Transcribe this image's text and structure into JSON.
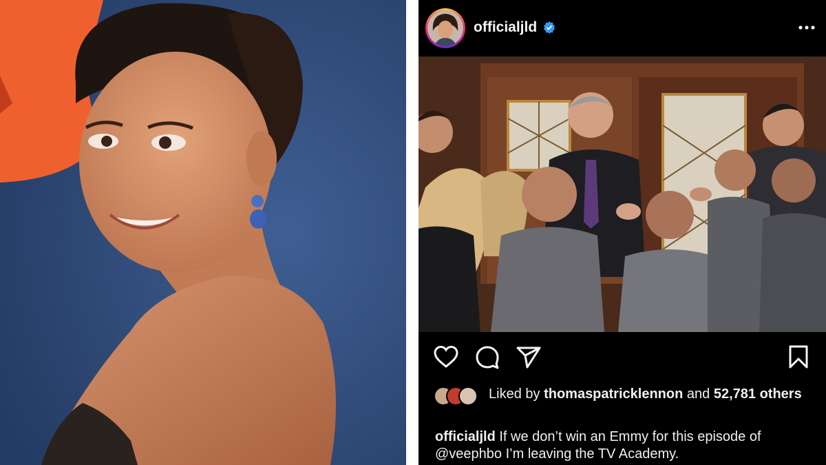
{
  "post": {
    "username": "officialjld",
    "verified": true,
    "likes": {
      "prefix": "Liked by",
      "liker": "thomaspatricklennon",
      "joiner": "and",
      "count": "52,781",
      "suffix": "others"
    },
    "caption": {
      "author": "officialjld",
      "text": "If we don’t win an Emmy for this episode of @veephbo I’m leaving the TV Academy."
    }
  },
  "icons": {
    "more": "more-horizontal-icon",
    "like": "heart-icon",
    "comment": "comment-icon",
    "share": "send-icon",
    "save": "bookmark-icon",
    "verified": "verified-badge-icon"
  },
  "colors": {
    "ig_background": "#000000",
    "verified_blue": "#3897f0",
    "text": "#f5f5f5"
  }
}
